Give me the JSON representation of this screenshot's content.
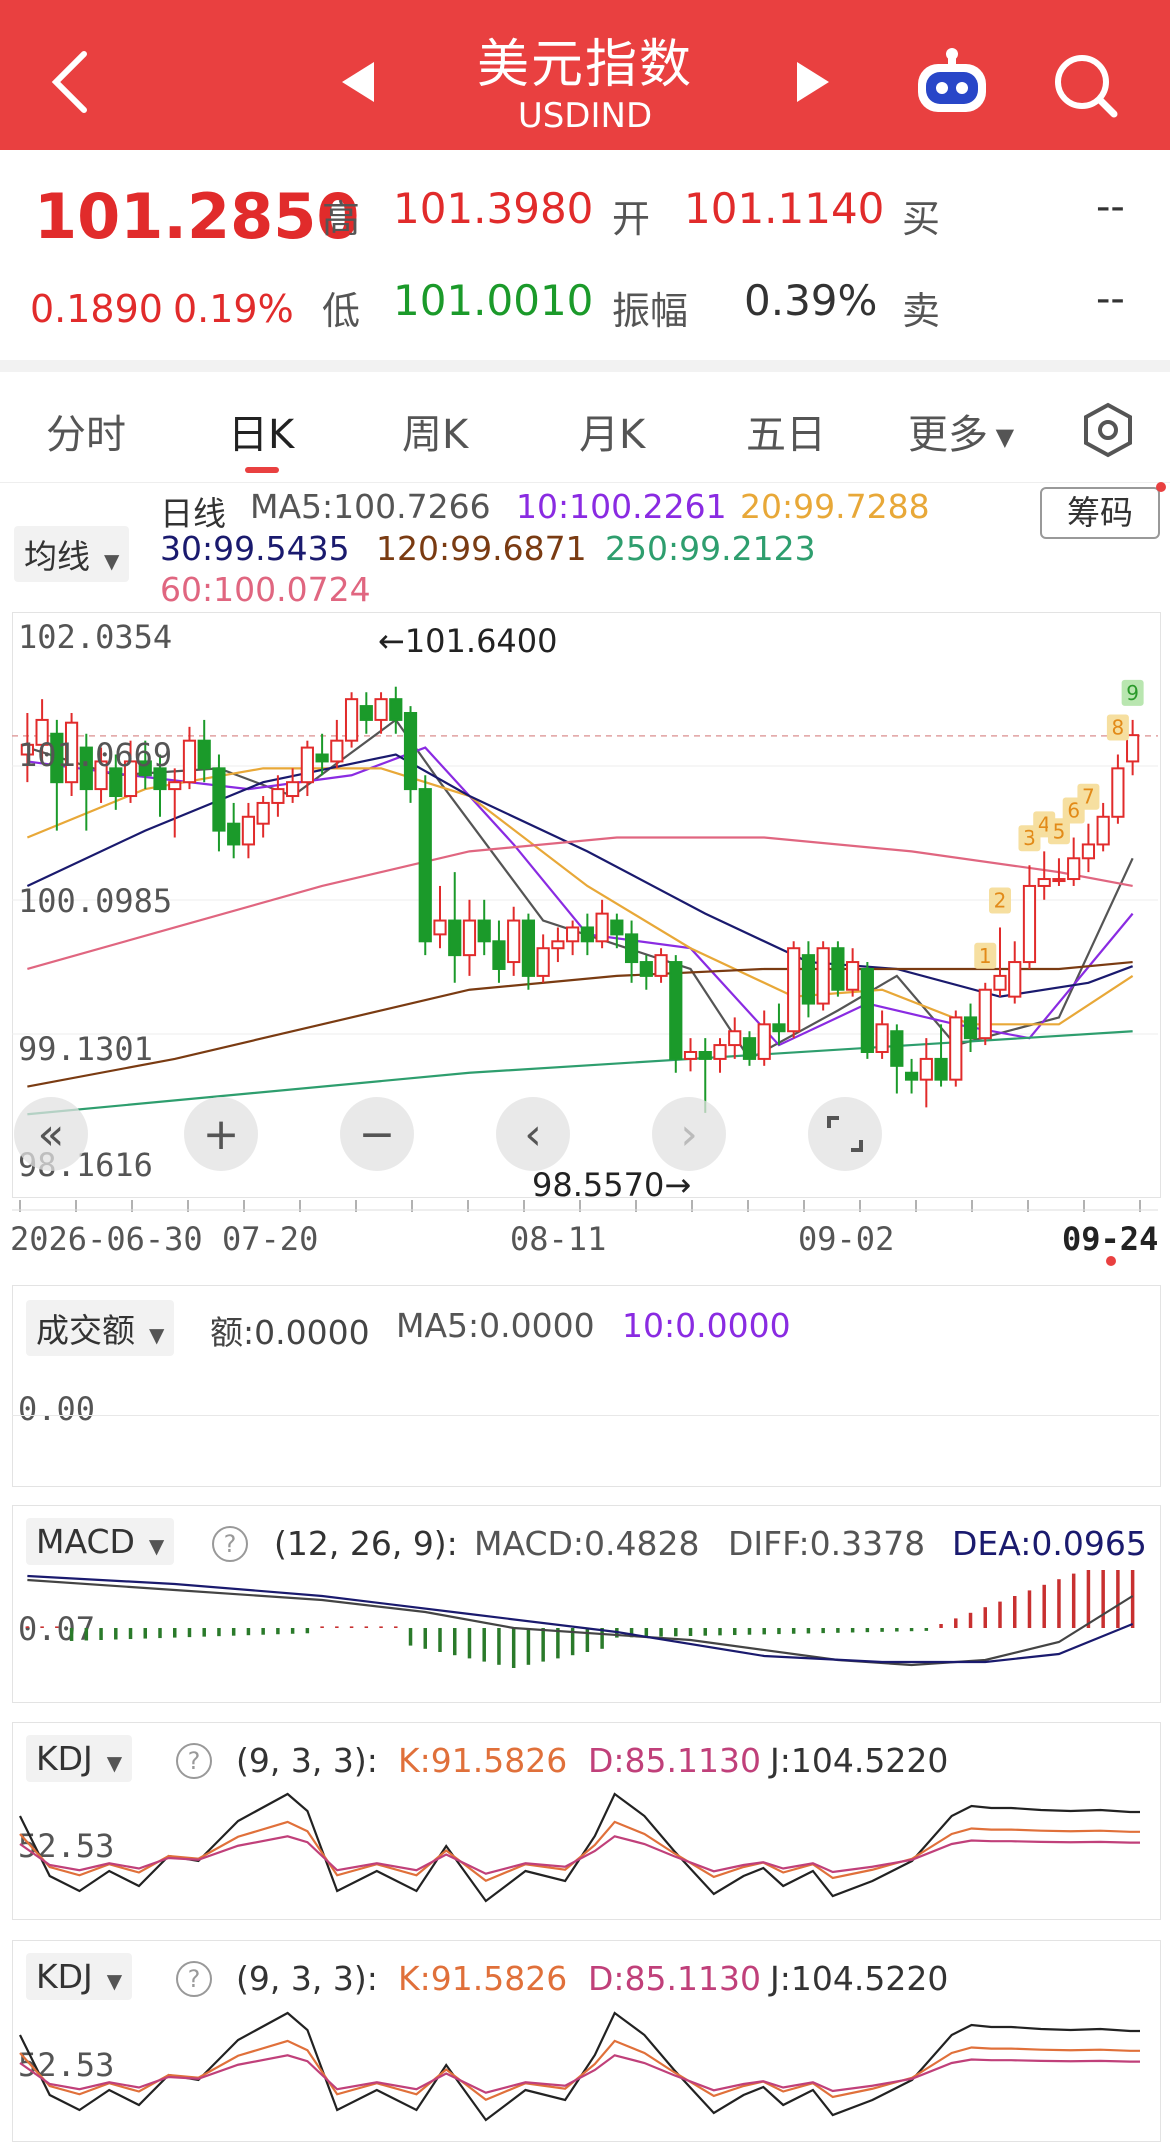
{
  "header": {
    "title": "美元指数",
    "subtitle": "USDIND"
  },
  "quote": {
    "price": "101.2850",
    "change": "0.1890",
    "change_pct": "0.19%",
    "high_label": "高",
    "high": "101.3980",
    "open_label": "开",
    "open": "101.1140",
    "low_label": "低",
    "low": "101.0010",
    "amp_label": "振幅",
    "amp": "0.39%",
    "buy_label": "买",
    "buy": "--",
    "sell_label": "卖",
    "sell": "--"
  },
  "tabs": [
    "分时",
    "日K",
    "周K",
    "月K",
    "五日",
    "更多"
  ],
  "ma_legend": {
    "selector": "均线",
    "period": "日线",
    "ma5": "MA5:100.7266",
    "ma10": "10:100.2261",
    "ma20": "20:99.7288",
    "ma30": "30:99.5435",
    "ma120": "120:99.6871",
    "ma250": "250:99.2123",
    "ma60": "60:100.0724",
    "chip_btn": "筹码"
  },
  "main_chart": {
    "y_labels": [
      "102.0354",
      "101.0669",
      "100.0985",
      "99.1301",
      "98.1616"
    ],
    "max_label": "←101.6400",
    "min_label": "98.5570→",
    "x_labels": [
      "2026-06-30",
      "07-20",
      "08-11",
      "09-02",
      "09-24"
    ],
    "ymin": 98.1616,
    "ymax": 102.0354
  },
  "chart_data": {
    "type": "candlestick",
    "ylim": [
      98.1616,
      102.0354
    ],
    "candles": [
      [
        101.15,
        101.22,
        101.45,
        100.95
      ],
      [
        101.22,
        101.4,
        101.55,
        101.1
      ],
      [
        101.3,
        100.95,
        101.4,
        100.6
      ],
      [
        100.95,
        101.38,
        101.45,
        100.85
      ],
      [
        101.2,
        100.9,
        101.3,
        100.6
      ],
      [
        100.9,
        101.1,
        101.2,
        100.8
      ],
      [
        101.05,
        100.85,
        101.15,
        100.75
      ],
      [
        100.85,
        101.1,
        101.25,
        100.8
      ],
      [
        101.1,
        101.0,
        101.25,
        100.9
      ],
      [
        101.05,
        100.9,
        101.15,
        100.7
      ],
      [
        100.9,
        100.95,
        101.05,
        100.55
      ],
      [
        100.95,
        101.25,
        101.35,
        100.9
      ],
      [
        101.25,
        101.05,
        101.4,
        100.95
      ],
      [
        101.05,
        100.6,
        101.15,
        100.45
      ],
      [
        100.65,
        100.5,
        100.8,
        100.4
      ],
      [
        100.5,
        100.7,
        100.8,
        100.4
      ],
      [
        100.65,
        100.8,
        100.85,
        100.55
      ],
      [
        100.8,
        100.9,
        101.0,
        100.7
      ],
      [
        100.85,
        100.95,
        101.05,
        100.8
      ],
      [
        100.95,
        101.2,
        101.25,
        100.85
      ],
      [
        101.15,
        101.1,
        101.3,
        101.0
      ],
      [
        101.1,
        101.25,
        101.4,
        101.05
      ],
      [
        101.25,
        101.55,
        101.6,
        101.2
      ],
      [
        101.5,
        101.4,
        101.6,
        101.3
      ],
      [
        101.4,
        101.55,
        101.6,
        101.3
      ],
      [
        101.55,
        101.4,
        101.64,
        101.3
      ],
      [
        101.45,
        100.9,
        101.5,
        100.8
      ],
      [
        100.9,
        99.8,
        101.0,
        99.7
      ],
      [
        99.85,
        99.95,
        100.2,
        99.75
      ],
      [
        99.95,
        99.7,
        100.3,
        99.5
      ],
      [
        99.7,
        99.95,
        100.1,
        99.55
      ],
      [
        99.95,
        99.8,
        100.1,
        99.7
      ],
      [
        99.8,
        99.6,
        99.95,
        99.5
      ],
      [
        99.65,
        99.95,
        100.05,
        99.55
      ],
      [
        99.95,
        99.55,
        100.0,
        99.45
      ],
      [
        99.55,
        99.75,
        99.85,
        99.5
      ],
      [
        99.75,
        99.8,
        99.9,
        99.65
      ],
      [
        99.8,
        99.9,
        99.95,
        99.7
      ],
      [
        99.9,
        99.8,
        100.0,
        99.7
      ],
      [
        99.8,
        100.0,
        100.1,
        99.75
      ],
      [
        99.95,
        99.85,
        100.0,
        99.75
      ],
      [
        99.85,
        99.65,
        99.95,
        99.5
      ],
      [
        99.65,
        99.55,
        99.7,
        99.45
      ],
      [
        99.55,
        99.7,
        99.75,
        99.5
      ],
      [
        99.65,
        98.95,
        99.7,
        98.85
      ],
      [
        98.95,
        99.0,
        99.1,
        98.86
      ],
      [
        99.0,
        98.95,
        99.1,
        98.56
      ],
      [
        98.95,
        99.05,
        99.1,
        98.85
      ],
      [
        99.05,
        99.15,
        99.25,
        98.95
      ],
      [
        99.1,
        98.95,
        99.15,
        98.9
      ],
      [
        98.95,
        99.2,
        99.3,
        98.9
      ],
      [
        99.2,
        99.15,
        99.35,
        99.05
      ],
      [
        99.15,
        99.75,
        99.8,
        99.1
      ],
      [
        99.7,
        99.35,
        99.8,
        99.25
      ],
      [
        99.35,
        99.75,
        99.8,
        99.3
      ],
      [
        99.75,
        99.45,
        99.8,
        99.4
      ],
      [
        99.45,
        99.65,
        99.75,
        99.4
      ],
      [
        99.6,
        99.0,
        99.65,
        98.95
      ],
      [
        99.0,
        99.2,
        99.3,
        98.95
      ],
      [
        99.15,
        98.9,
        99.2,
        98.7
      ],
      [
        98.85,
        98.8,
        98.95,
        98.7
      ],
      [
        98.8,
        98.95,
        99.1,
        98.6
      ],
      [
        98.95,
        98.8,
        99.2,
        98.75
      ],
      [
        98.8,
        99.25,
        99.3,
        98.75
      ],
      [
        99.25,
        99.1,
        99.35,
        99.0
      ],
      [
        99.1,
        99.45,
        99.5,
        99.05
      ],
      [
        99.45,
        99.55,
        99.9,
        99.4
      ],
      [
        99.4,
        99.65,
        99.8,
        99.35
      ],
      [
        99.65,
        100.2,
        100.35,
        99.6
      ],
      [
        100.2,
        100.25,
        100.45,
        100.1
      ],
      [
        100.25,
        100.25,
        100.4,
        100.2
      ],
      [
        100.25,
        100.4,
        100.55,
        100.2
      ],
      [
        100.4,
        100.5,
        100.65,
        100.3
      ],
      [
        100.5,
        100.7,
        100.8,
        100.45
      ],
      [
        100.7,
        101.05,
        101.15,
        100.65
      ],
      [
        101.1,
        101.29,
        101.4,
        101.0
      ]
    ],
    "ma_series": [
      {
        "name": "MA5",
        "color": "#555555",
        "values": [
          [
            0,
            101.2
          ],
          [
            6,
            101.0
          ],
          [
            13,
            101.05
          ],
          [
            18,
            100.85
          ],
          [
            25,
            101.4
          ],
          [
            28,
            100.95
          ],
          [
            35,
            99.95
          ],
          [
            45,
            99.6
          ],
          [
            49,
            98.95
          ],
          [
            55,
            99.3
          ],
          [
            59,
            99.55
          ],
          [
            63,
            99.05
          ],
          [
            70,
            99.25
          ],
          [
            75,
            100.4
          ]
        ]
      },
      {
        "name": "MA10",
        "color": "#8a2be2",
        "values": [
          [
            0,
            101.1
          ],
          [
            7,
            101.0
          ],
          [
            15,
            100.9
          ],
          [
            22,
            101.0
          ],
          [
            27,
            101.2
          ],
          [
            33,
            100.5
          ],
          [
            38,
            99.85
          ],
          [
            45,
            99.75
          ],
          [
            51,
            99.05
          ],
          [
            57,
            99.35
          ],
          [
            63,
            99.2
          ],
          [
            68,
            99.1
          ],
          [
            75,
            100.0
          ]
        ]
      },
      {
        "name": "MA20",
        "color": "#e8a838",
        "values": [
          [
            0,
            100.55
          ],
          [
            8,
            100.9
          ],
          [
            16,
            101.05
          ],
          [
            24,
            101.05
          ],
          [
            30,
            100.85
          ],
          [
            38,
            100.2
          ],
          [
            45,
            99.75
          ],
          [
            52,
            99.4
          ],
          [
            58,
            99.45
          ],
          [
            64,
            99.2
          ],
          [
            70,
            99.2
          ],
          [
            75,
            99.55
          ]
        ]
      },
      {
        "name": "MA30",
        "color": "#1a1a6e",
        "values": [
          [
            0,
            100.2
          ],
          [
            8,
            100.6
          ],
          [
            16,
            100.95
          ],
          [
            25,
            101.15
          ],
          [
            30,
            100.85
          ],
          [
            38,
            100.45
          ],
          [
            46,
            100.0
          ],
          [
            53,
            99.65
          ],
          [
            59,
            99.6
          ],
          [
            66,
            99.4
          ],
          [
            72,
            99.5
          ],
          [
            75,
            99.62
          ]
        ]
      },
      {
        "name": "MA60",
        "color": "#e06680",
        "values": [
          [
            0,
            99.6
          ],
          [
            10,
            99.9
          ],
          [
            20,
            100.2
          ],
          [
            30,
            100.45
          ],
          [
            40,
            100.55
          ],
          [
            50,
            100.55
          ],
          [
            60,
            100.45
          ],
          [
            70,
            100.3
          ],
          [
            75,
            100.2
          ]
        ]
      },
      {
        "name": "MA120",
        "color": "#7a3b12",
        "values": [
          [
            0,
            98.75
          ],
          [
            10,
            98.95
          ],
          [
            20,
            99.2
          ],
          [
            30,
            99.45
          ],
          [
            40,
            99.55
          ],
          [
            50,
            99.6
          ],
          [
            60,
            99.6
          ],
          [
            70,
            99.6
          ],
          [
            75,
            99.65
          ]
        ]
      },
      {
        "name": "MA250",
        "color": "#2e9e6e",
        "values": [
          [
            0,
            98.55
          ],
          [
            15,
            98.7
          ],
          [
            30,
            98.85
          ],
          [
            45,
            98.95
          ],
          [
            60,
            99.05
          ],
          [
            75,
            99.15
          ]
        ]
      }
    ],
    "td_markers": [
      {
        "label": "1",
        "i": 65,
        "yellow": true
      },
      {
        "label": "2",
        "i": 66,
        "yellow": true
      },
      {
        "label": "3",
        "i": 68,
        "yellow": true
      },
      {
        "label": "4",
        "i": 69,
        "yellow": true
      },
      {
        "label": "5",
        "i": 70,
        "yellow": true
      },
      {
        "label": "6",
        "i": 71,
        "yellow": true
      },
      {
        "label": "7",
        "i": 72,
        "yellow": true
      },
      {
        "label": "8",
        "i": 74,
        "yellow": true
      },
      {
        "label": "9",
        "i": 75,
        "yellow": false
      }
    ]
  },
  "volume": {
    "selector": "成交额",
    "amount": "额:0.0000",
    "ma5": "MA5:0.0000",
    "ma10": "10:0.0000",
    "y_label": "0.00"
  },
  "macd": {
    "selector": "MACD",
    "params": "(12, 26, 9):",
    "macd": "MACD:0.4828",
    "diff": "DIFF:0.3378",
    "dea": "DEA:0.0965",
    "y_label": "0.07"
  },
  "kdj1": {
    "selector": "KDJ",
    "params": "(9, 3, 3):",
    "k": "K:91.5826",
    "d": "D:85.1130",
    "j": "J:104.5220",
    "y_label": "52.53"
  },
  "kdj2": {
    "selector": "KDJ",
    "params": "(9, 3, 3):",
    "k": "K:91.5826",
    "d": "D:85.1130",
    "j": "J:104.5220",
    "y_label": "52.53"
  },
  "colors": {
    "header_bg": "#e94040",
    "up": "#e12b2b",
    "down": "#1b9a2a"
  }
}
